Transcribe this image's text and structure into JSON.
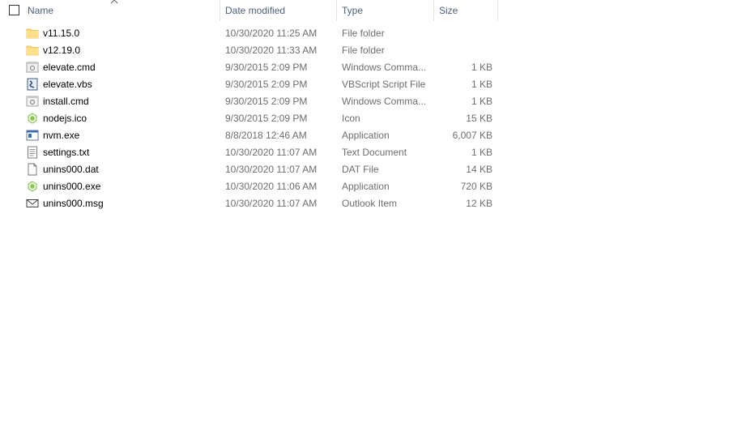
{
  "columns": {
    "name": "Name",
    "date": "Date modified",
    "type": "Type",
    "size": "Size"
  },
  "files": [
    {
      "icon": "folder-icon",
      "name": "v11.15.0",
      "date": "10/30/2020 11:25 AM",
      "type": "File folder",
      "size": ""
    },
    {
      "icon": "folder-icon",
      "name": "v12.19.0",
      "date": "10/30/2020 11:33 AM",
      "type": "File folder",
      "size": ""
    },
    {
      "icon": "cmd-script-icon",
      "name": "elevate.cmd",
      "date": "9/30/2015 2:09 PM",
      "type": "Windows Comma...",
      "size": "1 KB"
    },
    {
      "icon": "vbs-script-icon",
      "name": "elevate.vbs",
      "date": "9/30/2015 2:09 PM",
      "type": "VBScript Script File",
      "size": "1 KB"
    },
    {
      "icon": "cmd-script-icon",
      "name": "install.cmd",
      "date": "9/30/2015 2:09 PM",
      "type": "Windows Comma...",
      "size": "1 KB"
    },
    {
      "icon": "nodejs-icon",
      "name": "nodejs.ico",
      "date": "9/30/2015 2:09 PM",
      "type": "Icon",
      "size": "15 KB"
    },
    {
      "icon": "application-icon",
      "name": "nvm.exe",
      "date": "8/8/2018 12:46 AM",
      "type": "Application",
      "size": "6,007 KB"
    },
    {
      "icon": "text-document-icon",
      "name": "settings.txt",
      "date": "10/30/2020 11:07 AM",
      "type": "Text Document",
      "size": "1 KB"
    },
    {
      "icon": "blank-file-icon",
      "name": "unins000.dat",
      "date": "10/30/2020 11:07 AM",
      "type": "DAT File",
      "size": "14 KB"
    },
    {
      "icon": "nodejs-icon",
      "name": "unins000.exe",
      "date": "10/30/2020 11:06 AM",
      "type": "Application",
      "size": "720 KB"
    },
    {
      "icon": "envelope-icon",
      "name": "unins000.msg",
      "date": "10/30/2020 11:07 AM",
      "type": "Outlook Item",
      "size": "12 KB"
    }
  ]
}
